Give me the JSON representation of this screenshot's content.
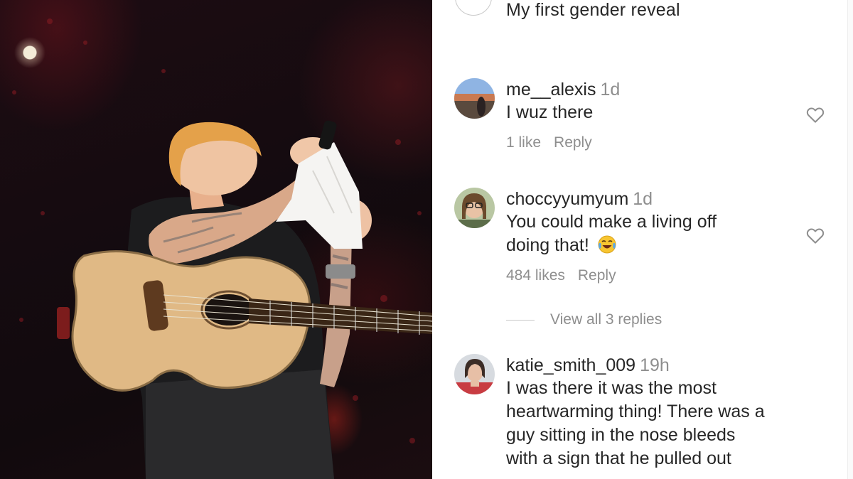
{
  "caption": {
    "text": "My first gender reveal"
  },
  "comments": [
    {
      "username": "me__alexis",
      "time": "1d",
      "text": "I wuz there",
      "likes": "1 like",
      "reply_label": "Reply"
    },
    {
      "username": "choccyyumyum",
      "time": "1d",
      "text_line1": "You could make a living off",
      "text_line2": "doing that!",
      "emoji": "tears-of-joy-emoji",
      "likes": "484 likes",
      "reply_label": "Reply",
      "view_replies": "View all 3 replies"
    },
    {
      "username": "katie_smith_009",
      "time": "19h",
      "text_lines": [
        "I was there it was the most",
        "heartwarming thing! There was a",
        "guy sitting in the nose bleeds",
        "with a sign that he pulled out"
      ]
    }
  ],
  "icons": {
    "like": "heart-outline-icon"
  },
  "colors": {
    "text": "#262626",
    "secondary": "#8e8e8e",
    "divider": "#c7c7c7"
  }
}
